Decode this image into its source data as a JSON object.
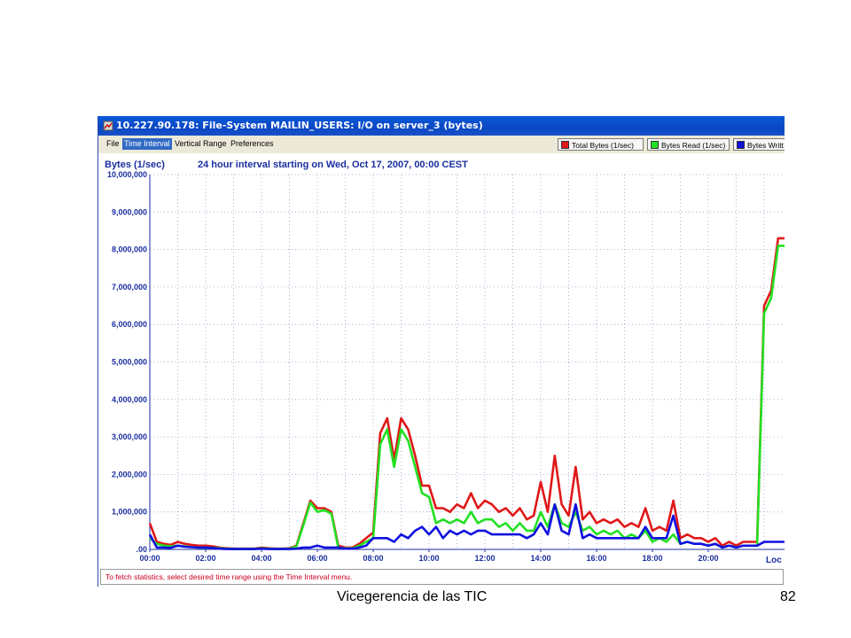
{
  "window": {
    "title": "10.227.90.178: File-System MAILIN_USERS: I/O on server_3 (bytes)",
    "icon": "window-app-icon"
  },
  "menu": {
    "items": [
      "File",
      "Time Interval",
      "Vertical Range",
      "Preferences"
    ],
    "selected": "Time Interval"
  },
  "legend": [
    {
      "label": "Total Bytes (1/sec)",
      "color": "#e01818"
    },
    {
      "label": "Bytes Read (1/sec)",
      "color": "#22e022"
    },
    {
      "label": "Bytes Writt",
      "color": "#1010e0"
    }
  ],
  "status_text": "To fetch statistics, select desired time range using the Time Interval menu.",
  "footer": {
    "left": "Vicegerencia de las TIC",
    "right": "82"
  },
  "chart_data": {
    "type": "line",
    "title": "24 hour interval starting on Wed, Oct 17, 2007, 00:00 CEST",
    "ylabel": "Bytes (1/sec)",
    "xlabel": "",
    "corner_label": "Loc",
    "ylim": [
      0,
      10000000
    ],
    "xlim": [
      0,
      22.75
    ],
    "grid": true,
    "x_ticks": [
      "00:00",
      "02:00",
      "04:00",
      "06:00",
      "08:00",
      "10:00",
      "12:00",
      "14:00",
      "16:00",
      "18:00",
      "20:00"
    ],
    "y_ticks": [
      ".00",
      "1,000,000",
      "2,000,000",
      "3,000,000",
      "4,000,000",
      "5,000,000",
      "6,000,000",
      "7,000,000",
      "8,000,000",
      "9,000,000",
      "10,000,000"
    ],
    "x": [
      0,
      0.25,
      0.5,
      0.75,
      1,
      1.25,
      1.5,
      1.75,
      2,
      2.25,
      2.5,
      2.75,
      3,
      3.25,
      3.5,
      3.75,
      4,
      4.25,
      4.5,
      4.75,
      5,
      5.25,
      5.5,
      5.75,
      6,
      6.25,
      6.5,
      6.75,
      7,
      7.25,
      7.5,
      7.75,
      8,
      8.25,
      8.5,
      8.75,
      9,
      9.25,
      9.5,
      9.75,
      10,
      10.25,
      10.5,
      10.75,
      11,
      11.25,
      11.5,
      11.75,
      12,
      12.25,
      12.5,
      12.75,
      13,
      13.25,
      13.5,
      13.75,
      14,
      14.25,
      14.5,
      14.75,
      15,
      15.25,
      15.5,
      15.75,
      16,
      16.25,
      16.5,
      16.75,
      17,
      17.25,
      17.5,
      17.75,
      18,
      18.25,
      18.5,
      18.75,
      19,
      19.25,
      19.5,
      19.75,
      20,
      20.25,
      20.5,
      20.75,
      21,
      21.25,
      21.5,
      21.75,
      22,
      22.25,
      22.5,
      22.75
    ],
    "series": [
      {
        "name": "Total Bytes (1/sec)",
        "color": "#e01818",
        "values": [
          700000,
          200000,
          150000,
          120000,
          200000,
          150000,
          120000,
          100000,
          100000,
          80000,
          50000,
          30000,
          20000,
          20000,
          20000,
          20000,
          50000,
          30000,
          20000,
          20000,
          30000,
          100000,
          700000,
          1300000,
          1100000,
          1100000,
          1000000,
          100000,
          50000,
          50000,
          150000,
          300000,
          450000,
          3100000,
          3500000,
          2400000,
          3500000,
          3200000,
          2500000,
          1700000,
          1700000,
          1100000,
          1100000,
          1000000,
          1200000,
          1100000,
          1500000,
          1100000,
          1300000,
          1200000,
          1000000,
          1100000,
          900000,
          1100000,
          800000,
          900000,
          1800000,
          1000000,
          2500000,
          1200000,
          900000,
          2200000,
          800000,
          1000000,
          700000,
          800000,
          700000,
          800000,
          600000,
          700000,
          600000,
          1100000,
          500000,
          600000,
          500000,
          1300000,
          300000,
          400000,
          300000,
          300000,
          200000,
          300000,
          100000,
          200000,
          100000,
          200000,
          200000,
          200000,
          6500000,
          6900000,
          8300000,
          8300000
        ]
      },
      {
        "name": "Bytes Read (1/sec)",
        "color": "#22e022",
        "values": [
          300000,
          150000,
          100000,
          80000,
          100000,
          80000,
          60000,
          50000,
          50000,
          40000,
          30000,
          20000,
          10000,
          10000,
          10000,
          10000,
          30000,
          20000,
          10000,
          10000,
          20000,
          80000,
          650000,
          1250000,
          1000000,
          1050000,
          950000,
          50000,
          30000,
          30000,
          100000,
          200000,
          300000,
          2800000,
          3200000,
          2200000,
          3200000,
          2900000,
          2200000,
          1500000,
          1400000,
          700000,
          800000,
          700000,
          800000,
          700000,
          1000000,
          700000,
          800000,
          800000,
          600000,
          700000,
          500000,
          700000,
          500000,
          500000,
          1000000,
          600000,
          1200000,
          700000,
          600000,
          1000000,
          500000,
          600000,
          400000,
          500000,
          400000,
          500000,
          300000,
          400000,
          300000,
          500000,
          200000,
          300000,
          200000,
          400000,
          150000,
          200000,
          150000,
          150000,
          100000,
          150000,
          50000,
          100000,
          50000,
          100000,
          100000,
          100000,
          6300000,
          6700000,
          8100000,
          8100000
        ]
      },
      {
        "name": "Bytes Writt",
        "color": "#1010e0",
        "values": [
          400000,
          50000,
          50000,
          40000,
          100000,
          70000,
          60000,
          50000,
          50000,
          40000,
          20000,
          10000,
          10000,
          10000,
          10000,
          10000,
          20000,
          10000,
          10000,
          10000,
          10000,
          20000,
          50000,
          50000,
          100000,
          50000,
          50000,
          50000,
          20000,
          20000,
          50000,
          100000,
          300000,
          300000,
          300000,
          200000,
          400000,
          300000,
          500000,
          600000,
          400000,
          600000,
          300000,
          500000,
          400000,
          500000,
          400000,
          500000,
          500000,
          400000,
          400000,
          400000,
          400000,
          400000,
          300000,
          400000,
          700000,
          400000,
          1200000,
          500000,
          400000,
          1200000,
          300000,
          400000,
          300000,
          300000,
          300000,
          300000,
          300000,
          300000,
          300000,
          600000,
          300000,
          300000,
          300000,
          900000,
          150000,
          200000,
          150000,
          150000,
          100000,
          150000,
          50000,
          100000,
          50000,
          100000,
          100000,
          100000,
          200000,
          200000,
          200000,
          200000
        ]
      }
    ]
  }
}
